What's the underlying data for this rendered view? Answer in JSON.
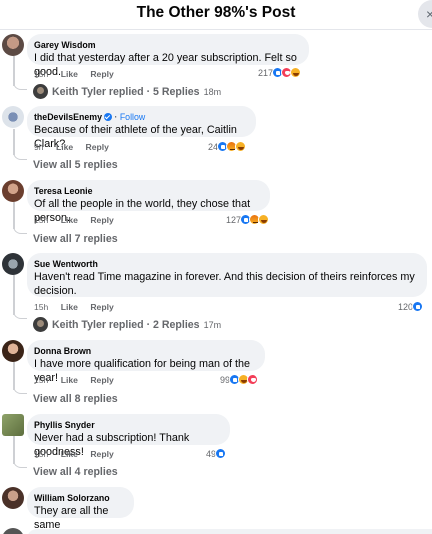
{
  "header": {
    "title": "The Other 98%'s Post",
    "close_glyph": "×"
  },
  "comments": [
    {
      "author": "Garey Wisdom",
      "text": "I did that yesterday after a 20 year subscription. Felt so good.",
      "time": "15h",
      "like": "Like",
      "reply": "Reply",
      "reaction_count": "217",
      "reactions": [
        "like",
        "love",
        "haha"
      ],
      "reply_preview": {
        "name": "Keith Tyler",
        "text": "Keith Tyler replied · 5 Replies",
        "time": "18m"
      }
    },
    {
      "author": "theDevilsEnemy",
      "verified": true,
      "follow_label": "Follow",
      "text": "Because of their athlete of the year, Caitlin Clark?",
      "time": "9h",
      "like": "Like",
      "reply": "Reply",
      "reaction_count": "24",
      "reactions": [
        "like",
        "angry",
        "haha"
      ],
      "view_all": "View all 5 replies"
    },
    {
      "author": "Teresa Leonie",
      "text": "Of all the people in the world, they chose that person.",
      "time": "15h",
      "like": "Like",
      "reply": "Reply",
      "reaction_count": "127",
      "reactions": [
        "like",
        "angry",
        "haha"
      ],
      "view_all": "View all 7 replies"
    },
    {
      "author": "Sue Wentworth",
      "text": "Haven't read Time magazine in forever. And this decision of theirs reinforces my decision.",
      "time": "15h",
      "like": "Like",
      "reply": "Reply",
      "reaction_count": "120",
      "reactions": [
        "like"
      ],
      "reply_preview": {
        "name": "Keith Tyler",
        "text": "Keith Tyler replied · 2 Replies",
        "time": "17m"
      }
    },
    {
      "author": "Donna Brown",
      "text": "I have more qualification for being man of the year!",
      "time": "15h",
      "like": "Like",
      "reply": "Reply",
      "reaction_count": "99",
      "reactions": [
        "like",
        "haha",
        "love"
      ],
      "view_all": "View all 8 replies"
    },
    {
      "author": "Phyllis Snyder",
      "text": "Never had a subscription! Thank goodness!",
      "time": "15h",
      "like": "Like",
      "reply": "Reply",
      "reaction_count": "49",
      "reactions": [
        "like"
      ],
      "view_all": "View all 4 replies"
    },
    {
      "author": "William Solorzano",
      "text": "They are all the same"
    }
  ],
  "colors": {
    "accent": "#1877f2",
    "bubble": "#f0f2f5",
    "meta": "#65676b"
  }
}
